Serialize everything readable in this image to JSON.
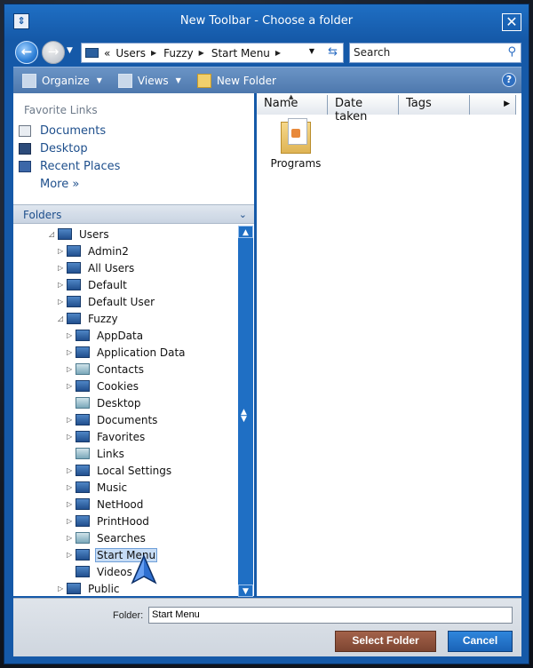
{
  "window": {
    "title": "New Toolbar - Choose a folder",
    "sysmenu_glyph": "⇕",
    "close_glyph": "✕"
  },
  "address": {
    "back_glyph": "←",
    "overflow": "«",
    "crumbs": [
      "Users",
      "Fuzzy",
      "Start Menu"
    ],
    "search_placeholder": "Search"
  },
  "toolbar": {
    "organize": "Organize",
    "views": "Views",
    "new_folder": "New Folder",
    "help_glyph": "?"
  },
  "favorites": {
    "title": "Favorite Links",
    "items": [
      {
        "label": "Documents",
        "icon": "documents-icon"
      },
      {
        "label": "Desktop",
        "icon": "desktop-icon"
      },
      {
        "label": "Recent Places",
        "icon": "recent-places-icon"
      }
    ],
    "more": "More"
  },
  "folders": {
    "title": "Folders",
    "tree": [
      {
        "label": "Users",
        "level": 0,
        "expanded": true
      },
      {
        "label": "Admin2",
        "level": 1
      },
      {
        "label": "All Users",
        "level": 1
      },
      {
        "label": "Default",
        "level": 1
      },
      {
        "label": "Default User",
        "level": 1
      },
      {
        "label": "Fuzzy",
        "level": 1,
        "expanded": true
      },
      {
        "label": "AppData",
        "level": 2
      },
      {
        "label": "Application Data",
        "level": 2
      },
      {
        "label": "Contacts",
        "level": 2,
        "special": true
      },
      {
        "label": "Cookies",
        "level": 2
      },
      {
        "label": "Desktop",
        "level": 2,
        "special": true,
        "leaf": true
      },
      {
        "label": "Documents",
        "level": 2
      },
      {
        "label": "Favorites",
        "level": 2
      },
      {
        "label": "Links",
        "level": 2,
        "special": true,
        "leaf": true
      },
      {
        "label": "Local Settings",
        "level": 2
      },
      {
        "label": "Music",
        "level": 2
      },
      {
        "label": "NetHood",
        "level": 2
      },
      {
        "label": "PrintHood",
        "level": 2
      },
      {
        "label": "Searches",
        "level": 2,
        "special": true
      },
      {
        "label": "Start Menu",
        "level": 2,
        "selected": true
      },
      {
        "label": "Videos",
        "level": 2,
        "leaf": true
      },
      {
        "label": "Public",
        "level": 1
      }
    ]
  },
  "columns": [
    "Name",
    "Date taken",
    "Tags"
  ],
  "files": [
    {
      "label": "Programs",
      "icon": "programs-folder-icon"
    }
  ],
  "footer": {
    "folder_label": "Folder:",
    "folder_value": "Start Menu",
    "select_button": "Select Folder",
    "cancel_button": "Cancel"
  },
  "colors": {
    "window_blue": "#1559a8",
    "select_button": "#8d5039",
    "cancel_button": "#1f6fc4"
  }
}
